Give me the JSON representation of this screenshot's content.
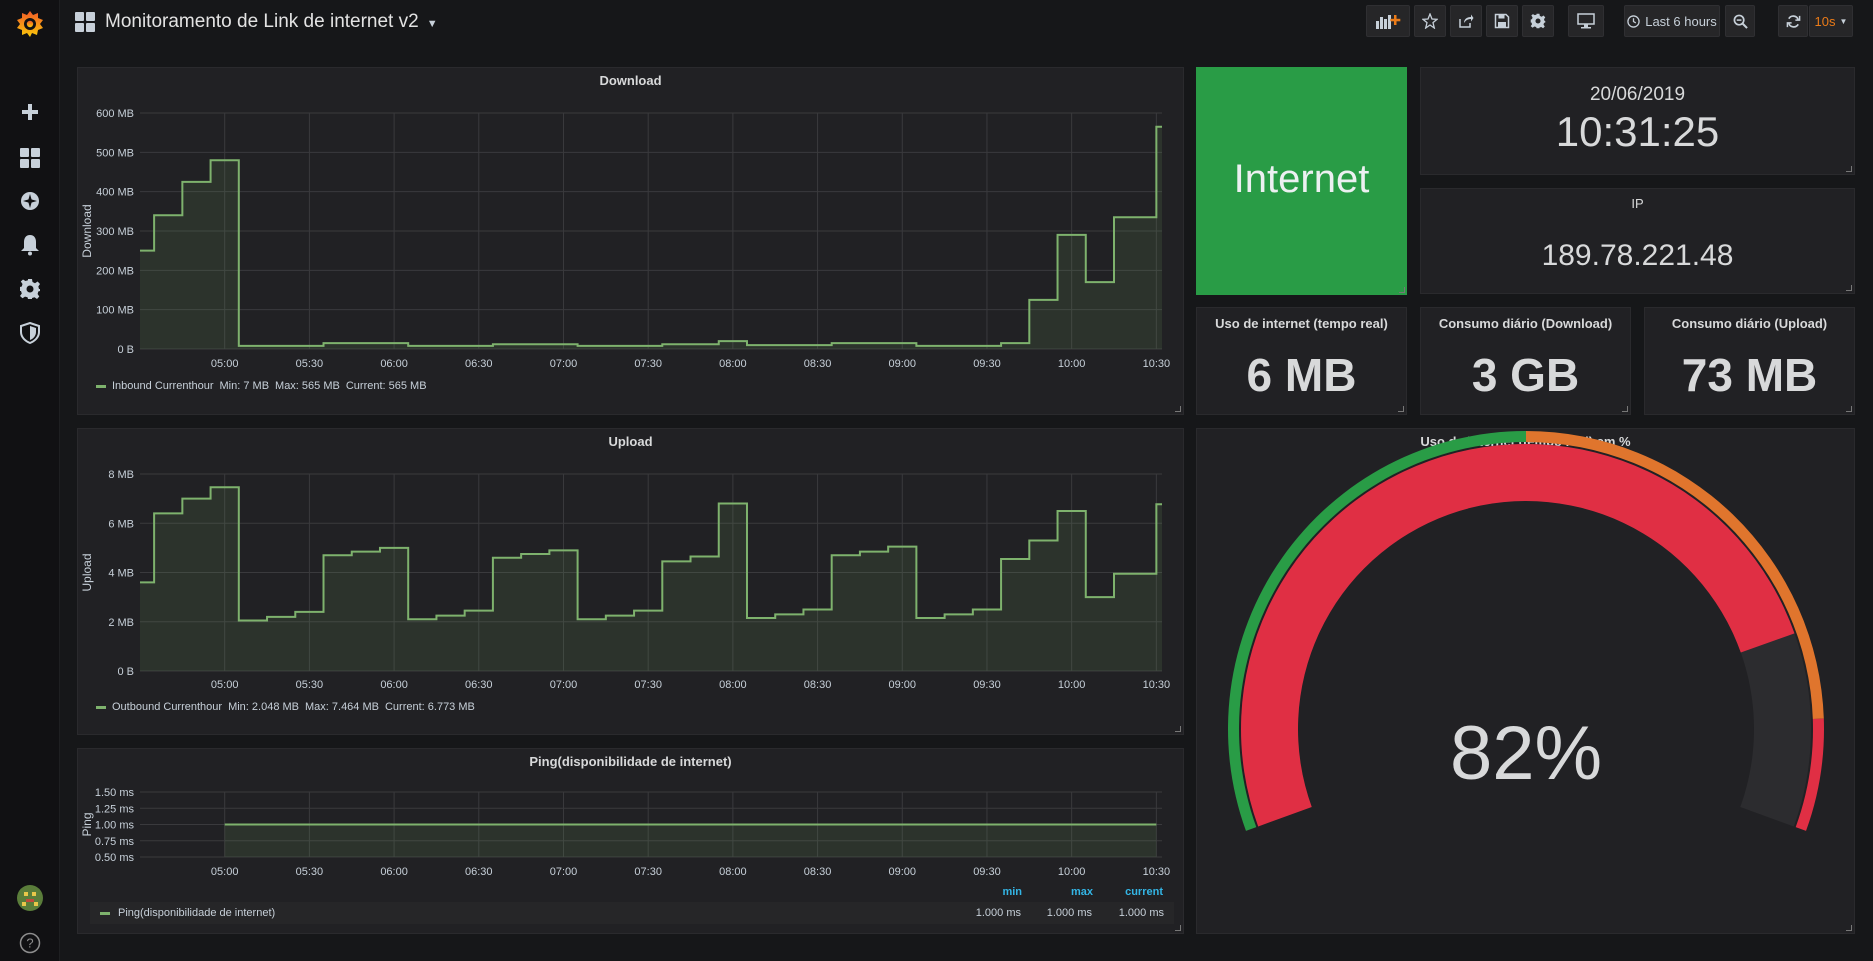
{
  "topbar": {
    "title": "Monitoramento de Link de internet v2",
    "time_range": "Last 6 hours",
    "refresh_interval": "10s"
  },
  "panels": {
    "download": {
      "title": "Download",
      "ylabel": "Download",
      "legend": {
        "series": "Inbound Currenthour",
        "min": "Min: 7 MB",
        "max": "Max: 565 MB",
        "current": "Current: 565 MB"
      }
    },
    "upload": {
      "title": "Upload",
      "ylabel": "Upload",
      "legend": {
        "series": "Outbound Currenthour",
        "min": "Min: 2.048 MB",
        "max": "Max: 7.464 MB",
        "current": "Current: 6.773 MB"
      }
    },
    "ping": {
      "title": "Ping(disponibilidade de internet)",
      "ylabel": "Ping",
      "legend_headers": {
        "min": "min",
        "max": "max",
        "current": "current"
      },
      "legend_row": {
        "series": "Ping(disponibilidade de internet)",
        "min": "1.000 ms",
        "max": "1.000 ms",
        "current": "1.000 ms"
      }
    },
    "internet_status": {
      "text": "Internet",
      "color": "#299c46"
    },
    "clock": {
      "date": "20/06/2019",
      "time": "10:31:25"
    },
    "ip": {
      "title": "IP",
      "value": "189.78.221.48"
    },
    "realtime_usage": {
      "title": "Uso de internet (tempo real)",
      "value": "6 MB"
    },
    "daily_download": {
      "title": "Consumo diário (Download)",
      "value": "3 GB"
    },
    "daily_upload": {
      "title": "Consumo diário (Upload)",
      "value": "73 MB"
    },
    "gauge": {
      "title": "Uso de internet (tempo real) em %",
      "value": 82,
      "value_text": "82%",
      "colors": {
        "ok": "#299c46",
        "warn": "#e0752d",
        "crit": "#e02f44"
      }
    }
  },
  "chart_data": [
    {
      "type": "area",
      "title": "Download",
      "ylabel": "Download",
      "x_ticks": [
        "05:00",
        "05:30",
        "06:00",
        "06:30",
        "07:00",
        "07:30",
        "08:00",
        "08:30",
        "09:00",
        "09:30",
        "10:00",
        "10:30"
      ],
      "y_ticks": [
        "0 B",
        "100 MB",
        "200 MB",
        "300 MB",
        "400 MB",
        "500 MB",
        "600 MB"
      ],
      "ylim": [
        0,
        600
      ],
      "unit": "MB",
      "x": [
        "04:30",
        "04:35",
        "04:40",
        "04:45",
        "04:50",
        "04:55",
        "05:00",
        "05:05",
        "05:10",
        "05:15",
        "05:20",
        "05:25",
        "05:30",
        "05:35",
        "05:40",
        "05:45",
        "05:50",
        "05:55",
        "06:00",
        "06:05",
        "06:10",
        "06:15",
        "06:20",
        "06:25",
        "06:30",
        "06:35",
        "06:40",
        "06:45",
        "06:50",
        "06:55",
        "07:00",
        "07:05",
        "07:10",
        "07:15",
        "07:20",
        "07:25",
        "07:30",
        "07:35",
        "07:40",
        "07:45",
        "07:50",
        "07:55",
        "08:00",
        "08:05",
        "08:10",
        "08:15",
        "08:20",
        "08:25",
        "08:30",
        "08:35",
        "08:40",
        "08:45",
        "08:50",
        "08:55",
        "09:00",
        "09:05",
        "09:10",
        "09:15",
        "09:20",
        "09:25",
        "09:30",
        "09:35",
        "09:40",
        "09:45",
        "09:50",
        "09:55",
        "10:00",
        "10:05",
        "10:10",
        "10:15",
        "10:20",
        "10:25",
        "10:30",
        "10:32"
      ],
      "series": [
        {
          "name": "Inbound Currenthour",
          "color": "#7eb26d",
          "values": [
            250,
            340,
            340,
            425,
            425,
            480,
            480,
            8,
            8,
            8,
            8,
            8,
            8,
            15,
            15,
            15,
            15,
            15,
            15,
            8,
            8,
            8,
            8,
            8,
            8,
            12,
            12,
            12,
            12,
            12,
            12,
            8,
            8,
            8,
            8,
            8,
            8,
            12,
            12,
            12,
            12,
            20,
            20,
            10,
            10,
            10,
            10,
            10,
            10,
            15,
            15,
            15,
            15,
            15,
            15,
            8,
            8,
            8,
            8,
            8,
            8,
            15,
            15,
            125,
            125,
            290,
            290,
            170,
            170,
            335,
            335,
            335,
            565,
            565
          ]
        }
      ]
    },
    {
      "type": "area",
      "title": "Upload",
      "ylabel": "Upload",
      "x_ticks": [
        "05:00",
        "05:30",
        "06:00",
        "06:30",
        "07:00",
        "07:30",
        "08:00",
        "08:30",
        "09:00",
        "09:30",
        "10:00",
        "10:30"
      ],
      "y_ticks": [
        "0 B",
        "2 MB",
        "4 MB",
        "6 MB",
        "8 MB"
      ],
      "ylim": [
        0,
        8
      ],
      "unit": "MB",
      "x": [
        "04:30",
        "04:35",
        "04:40",
        "04:45",
        "04:50",
        "04:55",
        "05:00",
        "05:05",
        "05:10",
        "05:15",
        "05:20",
        "05:25",
        "05:30",
        "05:35",
        "05:40",
        "05:45",
        "05:50",
        "05:55",
        "06:00",
        "06:05",
        "06:10",
        "06:15",
        "06:20",
        "06:25",
        "06:30",
        "06:35",
        "06:40",
        "06:45",
        "06:50",
        "06:55",
        "07:00",
        "07:05",
        "07:10",
        "07:15",
        "07:20",
        "07:25",
        "07:30",
        "07:35",
        "07:40",
        "07:45",
        "07:50",
        "07:55",
        "08:00",
        "08:05",
        "08:10",
        "08:15",
        "08:20",
        "08:25",
        "08:30",
        "08:35",
        "08:40",
        "08:45",
        "08:50",
        "08:55",
        "09:00",
        "09:05",
        "09:10",
        "09:15",
        "09:20",
        "09:25",
        "09:30",
        "09:35",
        "09:40",
        "09:45",
        "09:50",
        "09:55",
        "10:00",
        "10:05",
        "10:10",
        "10:15",
        "10:20",
        "10:25",
        "10:30",
        "10:32"
      ],
      "series": [
        {
          "name": "Outbound Currenthour",
          "color": "#7eb26d",
          "values": [
            3.6,
            6.4,
            6.4,
            7.0,
            7.0,
            7.46,
            7.46,
            2.05,
            2.05,
            2.2,
            2.2,
            2.4,
            2.4,
            4.7,
            4.7,
            4.85,
            4.85,
            5.0,
            5.0,
            2.1,
            2.1,
            2.25,
            2.25,
            2.45,
            2.45,
            4.6,
            4.6,
            4.75,
            4.75,
            4.9,
            4.9,
            2.1,
            2.1,
            2.25,
            2.25,
            2.45,
            2.45,
            4.45,
            4.45,
            4.65,
            4.65,
            6.8,
            6.8,
            2.15,
            2.15,
            2.3,
            2.3,
            2.5,
            2.5,
            4.7,
            4.7,
            4.85,
            4.85,
            5.05,
            5.05,
            2.15,
            2.15,
            2.3,
            2.3,
            2.5,
            2.5,
            4.55,
            4.55,
            5.3,
            5.3,
            6.5,
            6.5,
            3.0,
            3.0,
            3.95,
            3.95,
            3.95,
            6.77,
            6.77
          ]
        }
      ]
    },
    {
      "type": "area",
      "title": "Ping(disponibilidade de internet)",
      "ylabel": "Ping",
      "x_ticks": [
        "05:00",
        "05:30",
        "06:00",
        "06:30",
        "07:00",
        "07:30",
        "08:00",
        "08:30",
        "09:00",
        "09:30",
        "10:00",
        "10:30"
      ],
      "y_ticks": [
        "0.50 ms",
        "0.75 ms",
        "1.00 ms",
        "1.25 ms",
        "1.50 ms"
      ],
      "ylim": [
        0.5,
        1.5
      ],
      "unit": "ms",
      "x": [
        "05:00",
        "10:30"
      ],
      "series": [
        {
          "name": "Ping(disponibilidade de internet)",
          "color": "#7eb26d",
          "values": [
            1.0,
            1.0
          ]
        }
      ]
    },
    {
      "type": "gauge",
      "title": "Uso de internet (tempo real) em %",
      "value": 82,
      "unit": "%"
    }
  ]
}
